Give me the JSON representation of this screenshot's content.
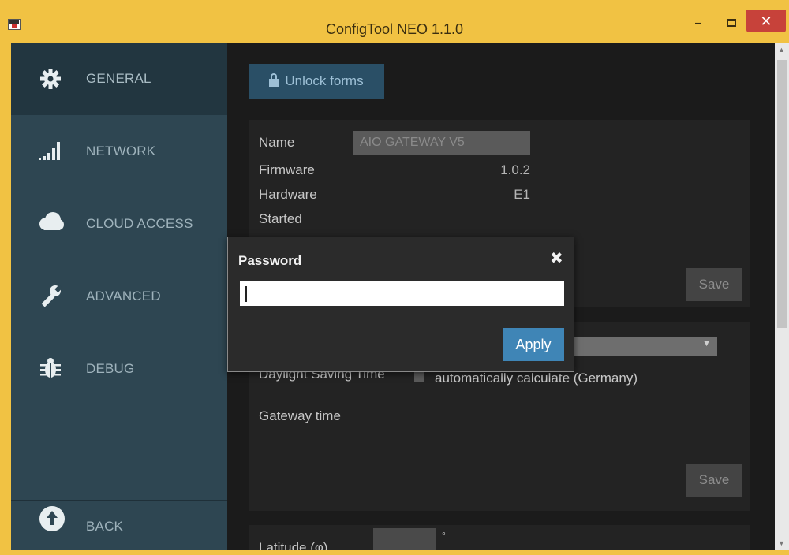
{
  "window": {
    "title": "ConfigTool NEO 1.1.0",
    "minimize": "–",
    "close": "✕"
  },
  "sidebar": {
    "items": [
      {
        "label": "GENERAL",
        "icon": "gear-icon",
        "active": true
      },
      {
        "label": "NETWORK",
        "icon": "signal-bars-icon",
        "active": false
      },
      {
        "label": "CLOUD ACCESS",
        "icon": "cloud-icon",
        "active": false
      },
      {
        "label": "ADVANCED",
        "icon": "wrench-icon",
        "active": false
      },
      {
        "label": "DEBUG",
        "icon": "bug-icon",
        "active": false
      }
    ],
    "back_label": "BACK"
  },
  "main": {
    "unlock_label": "Unlock forms",
    "device": {
      "name_label": "Name",
      "name_value": "AIO GATEWAY V5",
      "firmware_label": "Firmware",
      "firmware_value": "1.0.2",
      "hardware_label": "Hardware",
      "hardware_value": "E1",
      "started_label": "Started",
      "save_label": "Save"
    },
    "time": {
      "dst_label": "Daylight Saving Time",
      "auto_calc_label": "automatically calculate (Germany)",
      "gateway_time_label": "Gateway time",
      "save_label": "Save"
    },
    "location": {
      "latitude_label": "Latitude (φ)",
      "degree_symbol": "°"
    }
  },
  "dialog": {
    "title": "Password",
    "close": "✖",
    "password_value": "",
    "apply_label": "Apply"
  },
  "colors": {
    "title_bar": "#f1c243",
    "sidebar": "#2e4652",
    "sidebar_active": "#223640",
    "accent_button": "#3f85b6",
    "close_button": "#c7423a"
  }
}
